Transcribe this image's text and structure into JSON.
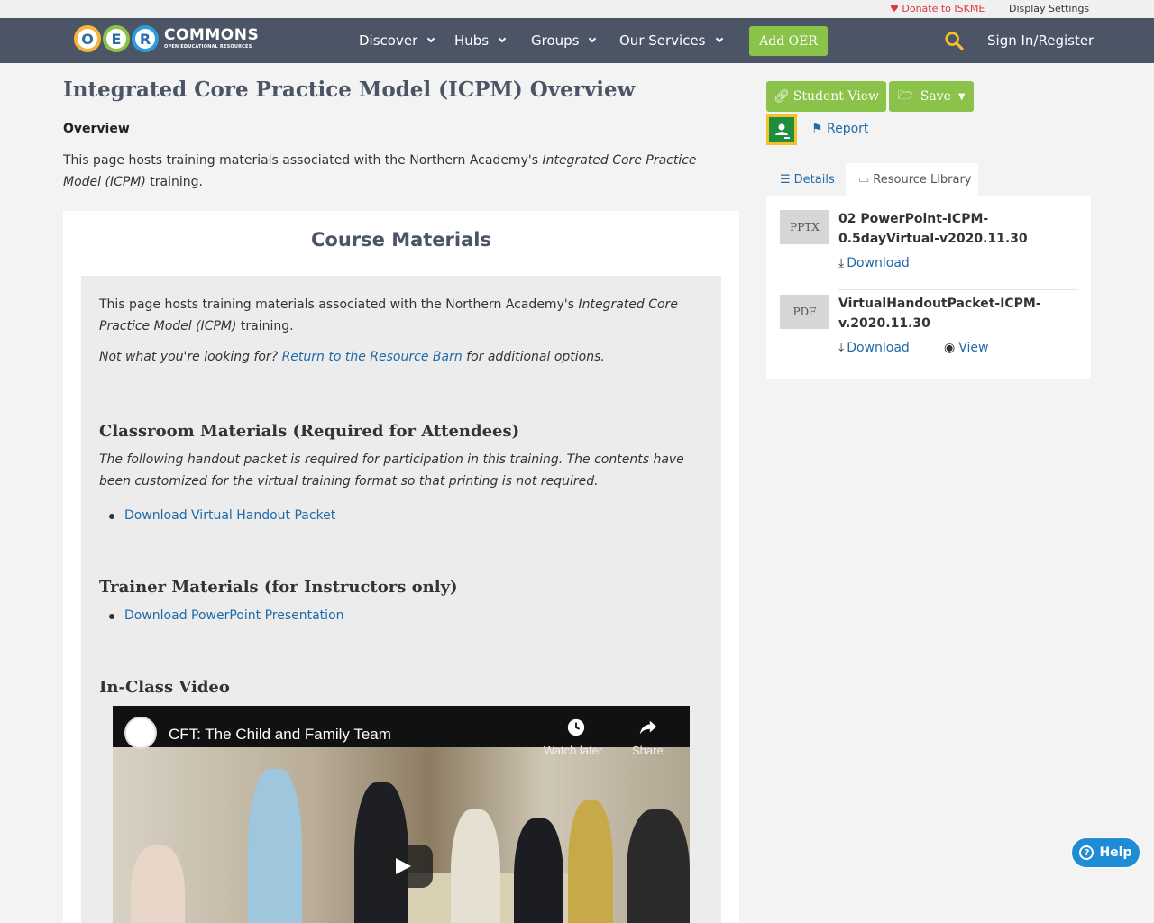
{
  "topbar": {
    "donate": "Donate to ISKME",
    "display_settings": "Display Settings"
  },
  "nav": {
    "logo_letters": [
      "O",
      "E",
      "R"
    ],
    "logo_word": "COMMONS",
    "logo_tagline": "OPEN EDUCATIONAL RESOURCES",
    "items": [
      "Discover",
      "Hubs",
      "Groups",
      "Our Services"
    ],
    "add_oer": "Add OER",
    "sign_in": "Sign In/Register"
  },
  "page": {
    "title": "Integrated Core Practice Model (ICPM) Overview",
    "overview_heading": "Overview",
    "overview_pre": "This page hosts training materials associated with the Northern Academy's ",
    "overview_em": "Integrated Core Practice Model (ICPM)",
    "overview_post": " training."
  },
  "course": {
    "title": "Course Materials",
    "intro_pre": "This page hosts training materials associated with the Northern Academy's ",
    "intro_em": "Integrated Core Practice Model (ICPM)",
    "intro_post": " training.",
    "not_pre": "Not what you're looking for? ",
    "not_link": "Return to the Resource Barn",
    "not_post": " for additional options.",
    "classroom_heading": "Classroom Materials (Required for Attendees)",
    "classroom_desc": "The following handout packet is required for participation in this training. The contents have been customized for the virtual training format so that printing is not required.",
    "classroom_link": "Download Virtual Handout Packet",
    "trainer_heading": "Trainer Materials (for Instructors only)",
    "trainer_link": "Download PowerPoint Presentation",
    "video_heading": "In-Class Video"
  },
  "video": {
    "title": "CFT: The Child and Family Team",
    "watch_later": "Watch later",
    "share": "Share"
  },
  "sidebar": {
    "student_view": "Student View",
    "save": "Save",
    "report": "Report",
    "tabs": [
      "Details",
      "Resource Library"
    ],
    "resources": [
      {
        "type": "PPTX",
        "title": "02 PowerPoint-ICPM-0.5dayVirtual-v2020.11.30",
        "download": "Download"
      },
      {
        "type": "PDF",
        "title": "VirtualHandoutPacket-ICPM-v.2020.11.30",
        "download": "Download",
        "view": "View"
      }
    ]
  },
  "help": {
    "label": "Help"
  }
}
